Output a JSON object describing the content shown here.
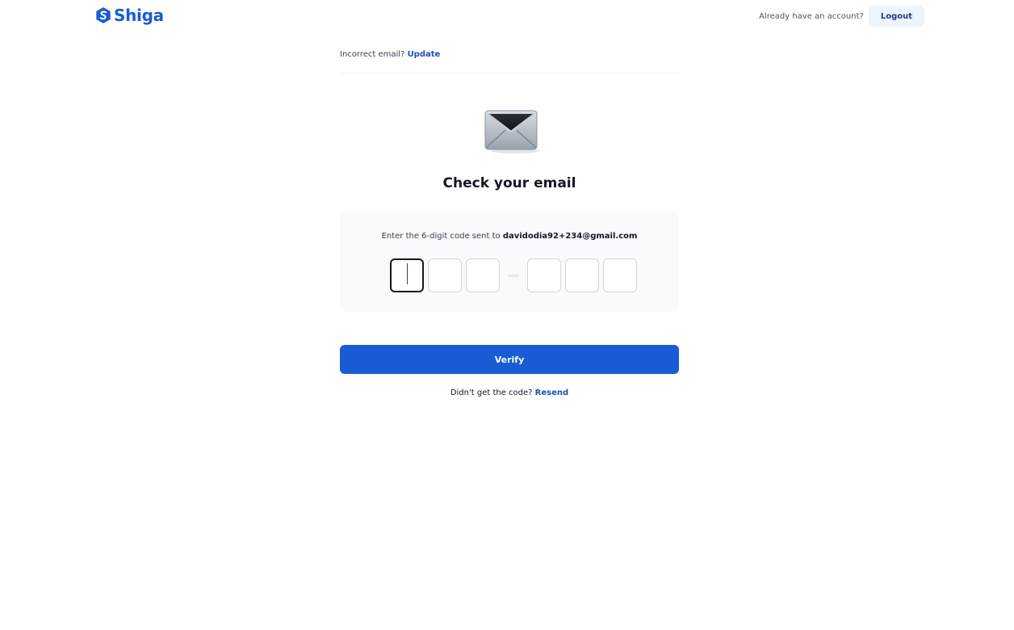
{
  "brand": {
    "name": "Shiga",
    "color": "#1a5bd6"
  },
  "header": {
    "account_prompt": "Already have an account?",
    "logout_label": "Logout"
  },
  "email_bar": {
    "prompt": "Incorrect email?",
    "update_label": "Update"
  },
  "hero": {
    "icon": "envelope-icon",
    "title": "Check your email"
  },
  "code_card": {
    "instruction": "Enter the 6-digit code sent to",
    "email": "davidodia92+234@gmail.com",
    "digits": [
      "",
      "",
      "",
      "",
      "",
      ""
    ]
  },
  "actions": {
    "verify_label": "Verify"
  },
  "resend": {
    "prompt": "Didn't get the code?",
    "resend_label": "Resend"
  }
}
